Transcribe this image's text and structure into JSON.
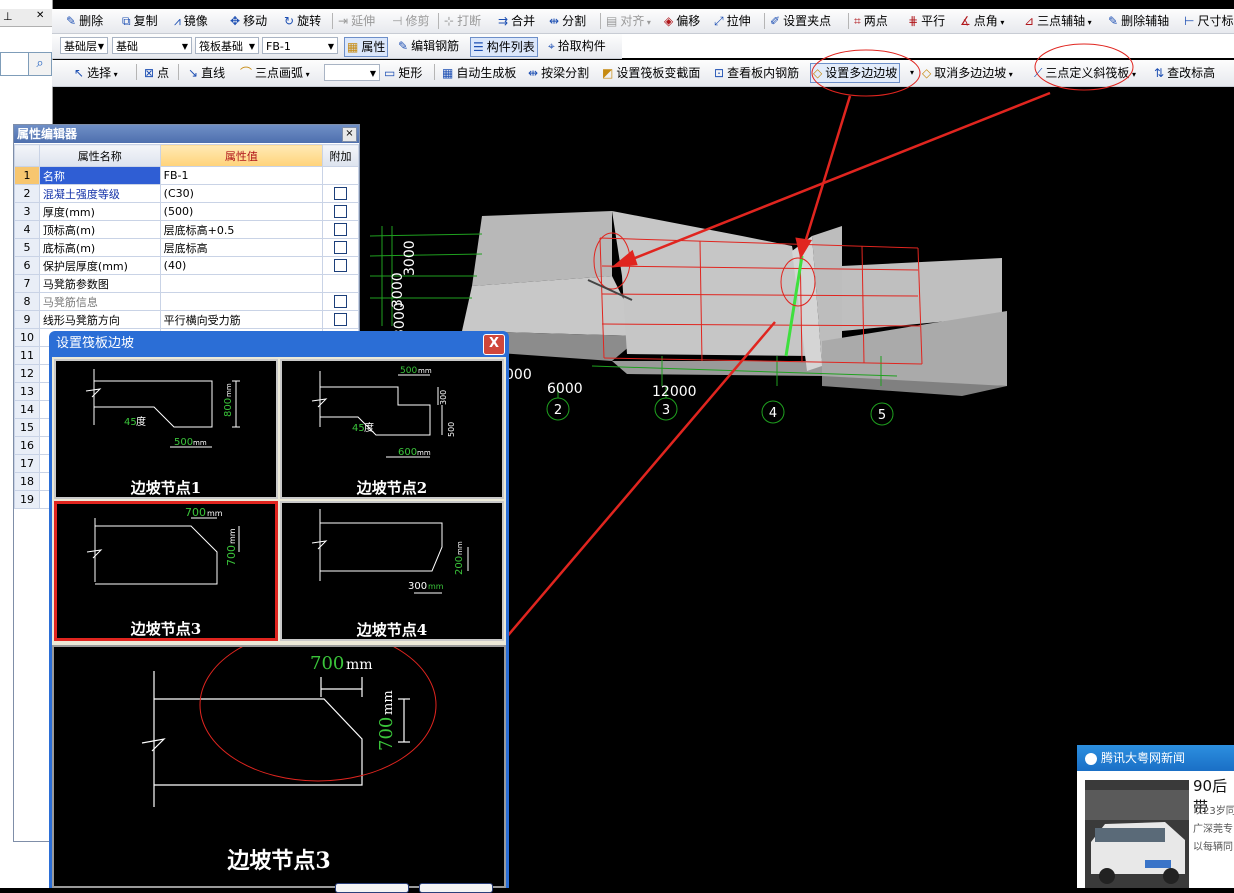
{
  "left_dock": {
    "pin_icon": "pin-icon",
    "pin_label": "⊥",
    "close_label": "✕"
  },
  "toolbar1": [
    {
      "name": "delete",
      "label": "删除",
      "icon": "✎"
    },
    {
      "name": "copy",
      "label": "复制",
      "icon": "⧉"
    },
    {
      "name": "mirror",
      "label": "镜像",
      "icon": "⩘"
    },
    {
      "name": "move",
      "label": "移动",
      "icon": "✥"
    },
    {
      "name": "rotate",
      "label": "旋转",
      "icon": "↻"
    },
    {
      "name": "extend",
      "label": "延伸",
      "icon": "⇥"
    },
    {
      "name": "trim",
      "label": "修剪",
      "icon": "⊣"
    },
    {
      "name": "break",
      "label": "打断",
      "icon": "⊹"
    },
    {
      "name": "merge",
      "label": "合并",
      "icon": "⇉"
    },
    {
      "name": "split",
      "label": "分割",
      "icon": "⇹"
    },
    {
      "name": "align",
      "label": "对齐",
      "icon": "▤"
    },
    {
      "name": "offset",
      "label": "偏移",
      "icon": "◈"
    },
    {
      "name": "stretch",
      "label": "拉伸",
      "icon": "⤢"
    },
    {
      "name": "set-grip",
      "label": "设置夹点",
      "icon": "✐"
    },
    {
      "name": "two-point",
      "label": "两点",
      "icon": "⌗"
    },
    {
      "name": "parallel",
      "label": "平行",
      "icon": "⋕"
    },
    {
      "name": "point-angle",
      "label": "点角",
      "icon": "∡"
    },
    {
      "name": "three-point-aux",
      "label": "三点辅轴",
      "icon": "⊿"
    },
    {
      "name": "delete-aux",
      "label": "删除辅轴",
      "icon": "✎"
    },
    {
      "name": "dimension",
      "label": "尺寸标",
      "icon": "⊢"
    }
  ],
  "toolbar2": {
    "layer_select": "基础层",
    "type_select": "基础",
    "subtype_select": "筏板基础",
    "element_select": "FB-1",
    "buttons": [
      {
        "name": "properties",
        "label": "属性",
        "icon": "▦"
      },
      {
        "name": "edit-rebar",
        "label": "编辑钢筋",
        "icon": "✎"
      },
      {
        "name": "element-list",
        "label": "构件列表",
        "icon": "☰"
      },
      {
        "name": "pick-element",
        "label": "拾取构件",
        "icon": "⌖"
      }
    ]
  },
  "toolbar3": {
    "select_label": "选择",
    "point_label": "点",
    "line_label": "直线",
    "arc_label": "三点画弧",
    "arc_select": "",
    "rect_label": "矩形",
    "auto_gen_label": "自动生成板",
    "beam_split_label": "按梁分割",
    "set_section_label": "设置筏板变截面",
    "view_rebar_label": "查看板内钢筋",
    "set_slope_label": "设置多边边坡",
    "cancel_slope_label": "取消多边边坡",
    "three_point_slope_label": "三点定义斜筏板",
    "change_elev_label": "查改标高"
  },
  "property_editor": {
    "title": "属性编辑器",
    "close": "×",
    "col_name": "属性名称",
    "col_value": "属性值",
    "col_extra": "附加",
    "rows": [
      {
        "no": "1",
        "name": "名称",
        "value": "FB-1",
        "cb": false
      },
      {
        "no": "2",
        "name": "混凝土强度等级",
        "value": "(C30)",
        "cb": true
      },
      {
        "no": "3",
        "name": "厚度(mm)",
        "value": "(500)",
        "cb": true
      },
      {
        "no": "4",
        "name": "顶标高(m)",
        "value": "层底标高+0.5",
        "cb": true
      },
      {
        "no": "5",
        "name": "底标高(m)",
        "value": "层底标高",
        "cb": true
      },
      {
        "no": "6",
        "name": "保护层厚度(mm)",
        "value": "(40)",
        "cb": true
      },
      {
        "no": "7",
        "name": "马凳筋参数图",
        "value": "",
        "cb": false
      },
      {
        "no": "8",
        "name": "马凳筋信息",
        "value": "",
        "cb": true
      },
      {
        "no": "9",
        "name": "线形马凳筋方向",
        "value": "平行横向受力筋",
        "cb": true
      },
      {
        "no": "10",
        "name": "",
        "value": "",
        "cb": false
      },
      {
        "no": "11",
        "name": "",
        "value": "",
        "cb": false
      },
      {
        "no": "12",
        "name": "",
        "value": "",
        "cb": false
      },
      {
        "no": "13",
        "name": "",
        "value": "",
        "cb": false
      },
      {
        "no": "14",
        "name": "",
        "value": "",
        "cb": false
      },
      {
        "no": "15",
        "name": "",
        "value": "",
        "cb": false
      },
      {
        "no": "16",
        "name": "",
        "value": "",
        "cb": false
      },
      {
        "no": "17",
        "name": "",
        "value": "",
        "cb": false
      },
      {
        "no": "18",
        "name": "",
        "value": "",
        "cb": false
      },
      {
        "no": "19",
        "name": "",
        "value": "",
        "cb": false
      }
    ]
  },
  "dialog": {
    "title": "设置筏板边坡",
    "close": "X",
    "nodes": [
      {
        "label": "边坡节点1",
        "dims": {
          "h": "800",
          "w": "500",
          "angle": "45",
          "angle_unit": "度",
          "unit": "mm"
        }
      },
      {
        "label": "边坡节点2",
        "dims": {
          "top": "500",
          "mid": "300",
          "low": "500",
          "bottom": "600",
          "angle": "45",
          "angle_unit": "度",
          "unit": "mm"
        }
      },
      {
        "label": "边坡节点3",
        "dims": {
          "w": "700",
          "h": "700",
          "unit": "mm"
        }
      },
      {
        "label": "边坡节点4",
        "dims": {
          "h": "200",
          "w": "300",
          "unit": "mm"
        }
      }
    ],
    "preview": {
      "label": "边坡节点3",
      "w": "700",
      "h": "700",
      "unit": "mm"
    }
  },
  "model_view": {
    "axis_labels": [
      "2",
      "3",
      "4",
      "5"
    ],
    "dims": {
      "a": "6000",
      "b": "12000",
      "c": "3000",
      "d": "3000",
      "e": "3000",
      "f": "000"
    }
  },
  "news": {
    "title": "腾讯大粤网新闻",
    "headline": "90后带",
    "lines": [
      "以23岁同",
      "广深莞专",
      "以每辆同"
    ]
  },
  "colors": {
    "annotation_red": "#e0251f",
    "dimension_green": "#3ac43a",
    "titlebar_blue": "#2b6ed6"
  }
}
